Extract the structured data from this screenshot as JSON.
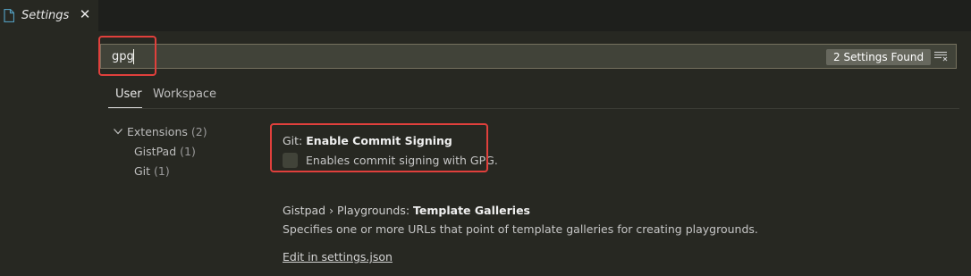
{
  "tab": {
    "label": "Settings",
    "icon": "file-icon",
    "close_icon": "close-icon"
  },
  "search": {
    "value": "gpg",
    "results_badge": "2 Settings Found",
    "clear_icon": "clear-filter-icon"
  },
  "scopes": {
    "user": "User",
    "workspace": "Workspace"
  },
  "toc": {
    "extensions_label": "Extensions",
    "extensions_count": "(2)",
    "gistpad_label": "GistPad",
    "gistpad_count": "(1)",
    "git_label": "Git",
    "git_count": "(1)"
  },
  "settings": [
    {
      "category": "Git: ",
      "name": "Enable Commit Signing",
      "description": "Enables commit signing with GPG.",
      "checked": false
    },
    {
      "category": "Gistpad › Playgrounds: ",
      "name": "Template Galleries",
      "description": "Specifies one or more URLs that point of template galleries for creating playgrounds.",
      "link": "Edit in settings.json"
    }
  ],
  "colors": {
    "background": "#272822",
    "highlight_border": "#e0403c",
    "input_background": "#414339"
  }
}
